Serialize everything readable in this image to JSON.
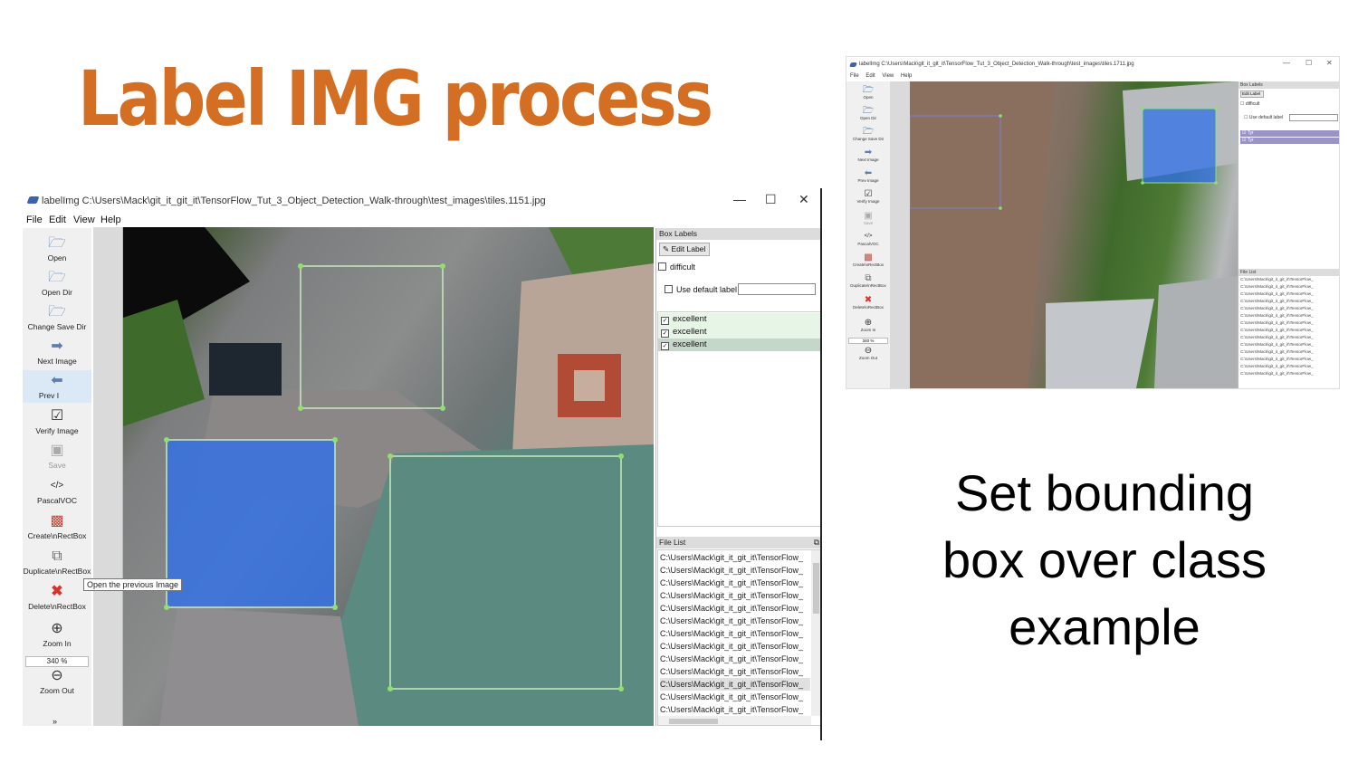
{
  "slide": {
    "title": "Label IMG process",
    "caption_line1": "Set bounding",
    "caption_line2": "box over class",
    "caption_line3": "example"
  },
  "main_window": {
    "title": "labelImg C:\\Users\\Mack\\git_it_git_it\\TensorFlow_Tut_3_Object_Detection_Walk-through\\test_images\\tiles.1151.jpg",
    "window_controls": {
      "minimize": "—",
      "maximize": "☐",
      "close": "✕"
    },
    "menu": [
      "File",
      "Edit",
      "View",
      "Help"
    ],
    "toolbar": [
      {
        "label": "Open",
        "icon": "folder-icon"
      },
      {
        "label": "Open Dir",
        "icon": "folder-icon"
      },
      {
        "label": "Change Save Dir",
        "icon": "folder-icon"
      },
      {
        "label": "Next Image",
        "icon": "arrow-right-icon"
      },
      {
        "label": "Prev Image",
        "icon": "arrow-left-icon"
      },
      {
        "label": "Verify Image",
        "icon": "check-icon"
      },
      {
        "label": "Save",
        "icon": "save-icon"
      },
      {
        "label": "PascalVOC",
        "icon": "code-icon"
      },
      {
        "label": "Create\\nRectBox",
        "icon": "create-rect-icon"
      },
      {
        "label": "Duplicate\\nRectBox",
        "icon": "duplicate-icon"
      },
      {
        "label": "Delete\\nRectBox",
        "icon": "delete-icon"
      },
      {
        "label": "Zoom In",
        "icon": "zoom-in-icon"
      },
      {
        "label": "Zoom Out",
        "icon": "zoom-out-icon"
      }
    ],
    "prev_label_visible": "Prev I",
    "tooltip": "Open the previous Image",
    "zoom_value": "340 %",
    "box_labels": {
      "header": "Box Labels",
      "edit_label": "Edit Label",
      "difficult": "difficult",
      "use_default_label": "Use default label",
      "default_label_value": "",
      "labels": [
        "excellent",
        "excellent",
        "excellent"
      ],
      "selected_index": 2
    },
    "file_list": {
      "header": "File List",
      "items": [
        "C:\\Users\\Mack\\git_it_git_it\\TensorFlow_",
        "C:\\Users\\Mack\\git_it_git_it\\TensorFlow_",
        "C:\\Users\\Mack\\git_it_git_it\\TensorFlow_",
        "C:\\Users\\Mack\\git_it_git_it\\TensorFlow_",
        "C:\\Users\\Mack\\git_it_git_it\\TensorFlow_",
        "C:\\Users\\Mack\\git_it_git_it\\TensorFlow_",
        "C:\\Users\\Mack\\git_it_git_it\\TensorFlow_",
        "C:\\Users\\Mack\\git_it_git_it\\TensorFlow_",
        "C:\\Users\\Mack\\git_it_git_it\\TensorFlow_",
        "C:\\Users\\Mack\\git_it_git_it\\TensorFlow_",
        "C:\\Users\\Mack\\git_it_git_it\\TensorFlow_",
        "C:\\Users\\Mack\\git_it_git_it\\TensorFlow_",
        "C:\\Users\\Mack\\git_it_git_it\\TensorFlow_",
        "C:\\Users\\Mack\\git_it_git_it\\TensorFlow_"
      ],
      "selected_index": 10
    },
    "colors": {
      "selected_box_fill": "#2f6fe8",
      "box_outline": "#b9e3b0",
      "vertex": "#8ee070"
    }
  },
  "small_window": {
    "title": "labelImg C:\\Users\\Mack\\git_it_git_it\\TensorFlow_Tut_3_Object_Detection_Walk-through\\test_images\\tiles.1711.jpg",
    "menu": [
      "File",
      "Edit",
      "View",
      "Help"
    ],
    "toolbar": [
      "Open",
      "Open Dir",
      "Change Save Dir",
      "Next Image",
      "Prev Image",
      "Verify Image",
      "Save",
      "PascalVOC",
      "Create\\nRectBox",
      "Duplicate\\nRectBox",
      "Delete\\nRectBox",
      "Zoom In",
      "Zoom Out"
    ],
    "zoom_value": "340 %",
    "box_labels_header": "Box Labels",
    "edit_label": "Edit Label",
    "difficult": "difficult",
    "use_default_label": "Use default label",
    "labels": [
      "Tyr",
      "Tyr"
    ],
    "file_list_header": "File List",
    "file_items": [
      "C:\\Users\\Mack\\git_it_git_it\\TensorFlow_",
      "C:\\Users\\Mack\\git_it_git_it\\TensorFlow_",
      "C:\\Users\\Mack\\git_it_git_it\\TensorFlow_",
      "C:\\Users\\Mack\\git_it_git_it\\TensorFlow_",
      "C:\\Users\\Mack\\git_it_git_it\\TensorFlow_",
      "C:\\Users\\Mack\\git_it_git_it\\TensorFlow_",
      "C:\\Users\\Mack\\git_it_git_it\\TensorFlow_",
      "C:\\Users\\Mack\\git_it_git_it\\TensorFlow_",
      "C:\\Users\\Mack\\git_it_git_it\\TensorFlow_",
      "C:\\Users\\Mack\\git_it_git_it\\TensorFlow_",
      "C:\\Users\\Mack\\git_it_git_it\\TensorFlow_",
      "C:\\Users\\Mack\\git_it_git_it\\TensorFlow_",
      "C:\\Users\\Mack\\git_it_git_it\\TensorFlow_",
      "C:\\Users\\Mack\\git_it_git_it\\TensorFlow_"
    ]
  }
}
